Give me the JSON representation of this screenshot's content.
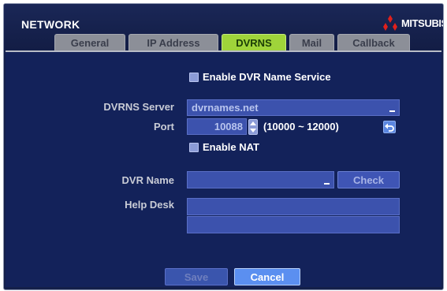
{
  "window": {
    "title": "NETWORK",
    "brand": "MITSUBISHI",
    "brand_color": "#e0201c"
  },
  "tabs": [
    {
      "label": "General",
      "active": false
    },
    {
      "label": "IP Address",
      "active": false
    },
    {
      "label": "DVRNS",
      "active": true
    },
    {
      "label": "Mail",
      "active": false
    },
    {
      "label": "Callback",
      "active": false
    }
  ],
  "form": {
    "enable_dvrns": {
      "label": "Enable DVR Name Service",
      "checked": false
    },
    "dvrns_server": {
      "label": "DVRNS Server",
      "value": "dvrnames.net"
    },
    "port": {
      "label": "Port",
      "value": "10088",
      "range": "(10000 ~ 12000)"
    },
    "enable_nat": {
      "label": "Enable NAT",
      "checked": false
    },
    "dvr_name": {
      "label": "DVR Name",
      "value": ""
    },
    "check_button": "Check",
    "help_desk": {
      "label": "Help Desk",
      "line1": "",
      "line2": ""
    }
  },
  "footer": {
    "save_label": "Save",
    "cancel_label": "Cancel"
  },
  "icons": {
    "logo": "mitsubishi-diamonds-icon",
    "stepper": "up-down-arrows-icon",
    "revert": "undo-arrow-icon"
  },
  "colors": {
    "background": "#13225a",
    "active_tab": "#9fd43a",
    "focused_button": "#5b8ff0"
  }
}
